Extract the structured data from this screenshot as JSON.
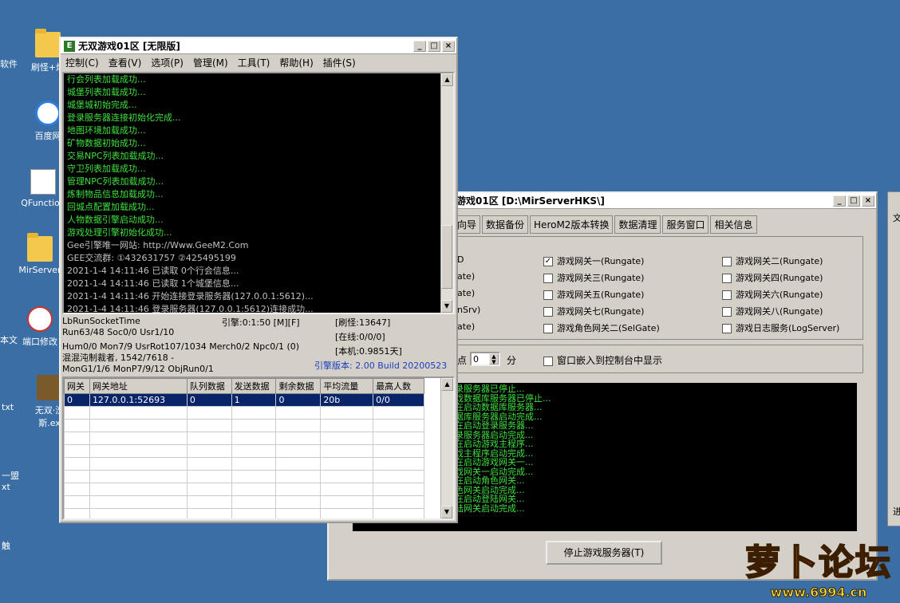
{
  "desktop": {
    "icons": [
      {
        "label": "软件"
      },
      {
        "label": "刷怪+爆"
      },
      {
        "label": "百度网"
      },
      {
        "label": "QFunction"
      },
      {
        "label": "MirServer"
      },
      {
        "label": "本文"
      },
      {
        "label": "端口修改"
      },
      {
        "label": "txt"
      },
      {
        "label": "无双·洗"
      },
      {
        "label": "斯.ex"
      },
      {
        "label": "一盟"
      },
      {
        "label": "xt"
      },
      {
        "label": "触"
      }
    ]
  },
  "m2": {
    "title": "无双游戏01区 [无限版]",
    "icon_letter": "E",
    "menus": [
      "控制(C)",
      "查看(V)",
      "选项(P)",
      "管理(M)",
      "工具(T)",
      "帮助(H)",
      "插件(S)"
    ],
    "log_lines": [
      "行会列表加载成功...",
      "城堡列表加载成功...",
      "城堡城初始完成...",
      "登录服务器连接初始化完成...",
      "地图环境加载成功...",
      "矿物数据初始成功...",
      "交易NPC列表加载成功...",
      "守卫列表加载成功...",
      "管理NPC列表加载成功...",
      "炼制物品信息加载成功...",
      "回城点配置加载成功...",
      "人物数据引擎启动成功...",
      "游戏处理引擎初始化成功...",
      "Gee引擎唯一网站: http://Www.GeeM2.Com",
      "GEE交流群: ①432631757    ②425495199",
      "2021-1-4 14:11:46 已读取 0个行会信息...",
      "2021-1-4 14:11:46 已读取 1个城堡信息...",
      "2021-1-4 14:11:46 开始连接登录服务器(127.0.0.1:5612)...",
      "2021-1-4 14:11:46 登录服务器(127.0.0.1:5612)连接成功..."
    ],
    "status": {
      "l1": "LbRunSocketTime",
      "engine_time": "引擎:0:1:50 [M][F]",
      "brush": "[刷怪:13647]",
      "l2": "Run63/48 Soc0/0 Usr1/10",
      "online": "[在线:0/0/0]",
      "l3": "Hum0/0 Mon7/9 UsrRot107/1034 Merch0/2 Npc0/1 (0)",
      "local": "[本机:0.9851天]",
      "l4": "混混沌制裁者, 1542/7618 -",
      "l5": "MonG1/1/6 MonP7/9/12 ObjRun0/1",
      "version": "引擎版本: 2.00 Build 20200523"
    },
    "table": {
      "headers": [
        "网关",
        "网关地址",
        "队列数据",
        "发送数据",
        "剩余数据",
        "平均流量",
        "最高人数"
      ],
      "rows": [
        [
          "0",
          "127.0.0.1:52693",
          "0",
          "1",
          "0",
          "20b",
          "0/0"
        ]
      ]
    }
  },
  "ctrl": {
    "title": "游戏01区 [D:\\MirServerHKS\\]",
    "tabs": [
      "向导",
      "数据备份",
      "HeroM2版本转换",
      "数据清理",
      "服务窗口",
      "相关信息"
    ],
    "checkboxes": [
      {
        "label": "游戏网关一(Rungate)",
        "checked": true
      },
      {
        "label": "游戏网关二(Rungate)",
        "checked": false
      },
      {
        "label": "游戏网关三(Rungate)",
        "checked": false
      },
      {
        "label": "游戏网关四(Rungate)",
        "checked": false
      },
      {
        "label": "游戏网关五(Rungate)",
        "checked": false
      },
      {
        "label": "游戏网关六(Rungate)",
        "checked": false
      },
      {
        "label": "游戏网关七(Rungate)",
        "checked": false
      },
      {
        "label": "游戏网关八(Rungate)",
        "checked": false
      },
      {
        "label": "游戏角色网关二(SelGate)",
        "checked": false
      },
      {
        "label": "游戏日志服务(LogServer)",
        "checked": false
      }
    ],
    "partial_left": [
      "D",
      "ate)",
      "ate)",
      "nSrv)",
      "ate)"
    ],
    "timer_prefix": "点",
    "timer_value": "0",
    "timer_unit": "分",
    "embed_label": "窗口嵌入到控制台中显示",
    "log_lines": [
      "录服务器已停止...",
      "戏数据库服务器已停止...",
      "在启动数据库服务器...",
      "据库服务器启动完成...",
      "在启动登录服务器...",
      "录服务器启动完成...",
      "在启动游戏主程序...",
      "戏主程序启动完成...",
      "在启动游戏网关一...",
      "戏网关一启动完成...",
      "在启动角色网关...",
      "色网关启动完成...",
      "在启动登陆网关...",
      "陆网关启动完成..."
    ],
    "stop_button": "停止游戏服务器(T)"
  },
  "watermark": {
    "text": "萝卜论坛",
    "url": "www.6994.cn"
  },
  "right_edge": {
    "text1": "文",
    "text2": "进"
  }
}
